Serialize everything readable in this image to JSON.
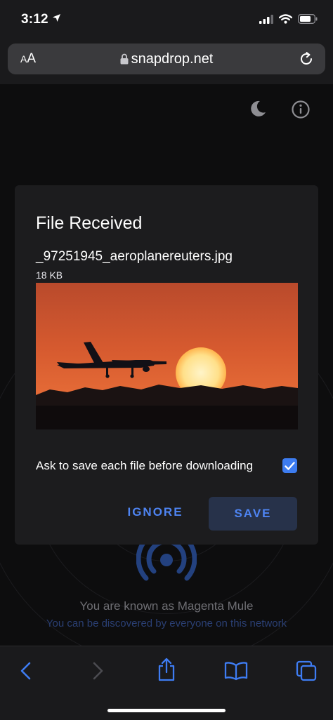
{
  "status_bar": {
    "time": "3:12"
  },
  "browser": {
    "text_size_label_small": "A",
    "text_size_label_large": "A",
    "url": "snapdrop.net"
  },
  "dialog": {
    "title": "File Received",
    "file_name": "_97251945_aeroplanereuters.jpg",
    "file_size": "18 KB",
    "ask_label": "Ask to save each file before downloading",
    "ask_checked": true,
    "ignore_label": "IGNORE",
    "save_label": "SAVE"
  },
  "footer": {
    "known_as": "You are known as Magenta Mule",
    "discover": "You can be discovered by everyone on this network"
  },
  "colors": {
    "accent": "#4e84f2",
    "checkbox": "#3d7cf0",
    "save_button_bg": "#27324a",
    "dialog_bg": "#1c1c1e"
  },
  "icons": {
    "status": [
      "location-arrow-icon",
      "cellular-signal-icon",
      "wifi-icon",
      "battery-icon"
    ],
    "page": [
      "moon-icon",
      "info-icon",
      "broadcast-icon"
    ],
    "toolbar": [
      "back-icon",
      "forward-icon",
      "share-icon",
      "bookmarks-icon",
      "tabs-icon"
    ]
  }
}
